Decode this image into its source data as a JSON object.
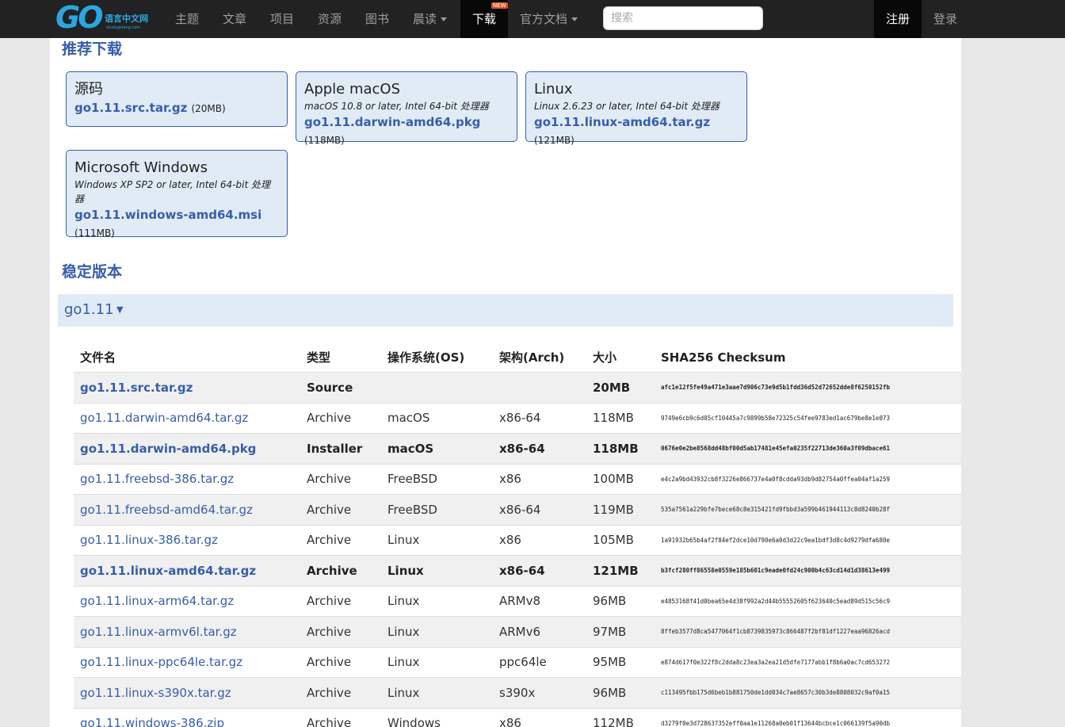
{
  "nav": {
    "logo_go": "GO",
    "logo_cn": "语言中文网",
    "logo_en": "studygolang.com",
    "items": [
      "主题",
      "文章",
      "项目",
      "资源",
      "图书",
      "晨读",
      "下载",
      "官方文档"
    ],
    "new_badge": "NEW",
    "search_placeholder": "搜索",
    "register": "注册",
    "login": "登录"
  },
  "recommended": {
    "title": "推荐下载",
    "cards": [
      {
        "title": "源码",
        "sub": "",
        "file": "go1.11.src.tar.gz",
        "size": "(20MB)"
      },
      {
        "title": "Apple macOS",
        "sub": "macOS 10.8 or later, Intel 64-bit 处理器",
        "file": "go1.11.darwin-amd64.pkg",
        "size": "(118MB)"
      },
      {
        "title": "Linux",
        "sub": "Linux 2.6.23 or later, Intel 64-bit 处理器",
        "file": "go1.11.linux-amd64.tar.gz",
        "size": "(121MB)"
      },
      {
        "title": "Microsoft Windows",
        "sub": "Windows XP SP2 or later, Intel 64-bit 处理器",
        "file": "go1.11.windows-amd64.msi",
        "size": "(111MB)"
      }
    ]
  },
  "stable": {
    "title": "稳定版本",
    "version": "go1.11",
    "toggle": "▼"
  },
  "table": {
    "headers": [
      "文件名",
      "类型",
      "操作系统(OS)",
      "架构(Arch)",
      "大小",
      "SHA256 Checksum"
    ],
    "rows": [
      {
        "file": "go1.11.src.tar.gz",
        "kind": "Source",
        "os": "",
        "arch": "",
        "size": "20MB",
        "sha": "afc1e12f5fe49a471e3aae7d906c73e9d5b1fdd36d52d72652dde8f6250152fb",
        "hl": true
      },
      {
        "file": "go1.11.darwin-amd64.tar.gz",
        "kind": "Archive",
        "os": "macOS",
        "arch": "x86-64",
        "size": "118MB",
        "sha": "9749e6cb9c6d05cf10445a7c9899b58e72325c54fee9783ed1ac679be8e1e073",
        "hl": false
      },
      {
        "file": "go1.11.darwin-amd64.pkg",
        "kind": "Installer",
        "os": "macOS",
        "arch": "x86-64",
        "size": "118MB",
        "sha": "0676e0e2be8568dd48bf00d5ab17481e45efa0235f22713de360a3f09dbace61",
        "hl": true
      },
      {
        "file": "go1.11.freebsd-386.tar.gz",
        "kind": "Archive",
        "os": "FreeBSD",
        "arch": "x86",
        "size": "100MB",
        "sha": "e4c2a9bd43932cb8f3226e866737e4a0f8cdda93db9d82754a0ffea04af1a259",
        "hl": false
      },
      {
        "file": "go1.11.freebsd-amd64.tar.gz",
        "kind": "Archive",
        "os": "FreeBSD",
        "arch": "x86-64",
        "size": "119MB",
        "sha": "535a7561a229bfe7bece68c8e315421fd9fbbd3a599b461944113c8d8240b28f",
        "hl": false
      },
      {
        "file": "go1.11.linux-386.tar.gz",
        "kind": "Archive",
        "os": "Linux",
        "arch": "x86",
        "size": "105MB",
        "sha": "1a91932b65b4af2f84ef2dce10d790e6a0d3d22c9ea1bdf3d8c4d9279dfa680e",
        "hl": false
      },
      {
        "file": "go1.11.linux-amd64.tar.gz",
        "kind": "Archive",
        "os": "Linux",
        "arch": "x86-64",
        "size": "121MB",
        "sha": "b3fcf280ff86558e0559e185b601c9eade0fd24c900b4c63cd14d1d38613e499",
        "hl": true
      },
      {
        "file": "go1.11.linux-arm64.tar.gz",
        "kind": "Archive",
        "os": "Linux",
        "arch": "ARMv8",
        "size": "96MB",
        "sha": "e4853168f41d0bea65e4d38f992a2d44b55552605f623640c5ead89d515c56c9",
        "hl": false
      },
      {
        "file": "go1.11.linux-armv6l.tar.gz",
        "kind": "Archive",
        "os": "Linux",
        "arch": "ARMv6",
        "size": "97MB",
        "sha": "8ffeb3577d8ca5477064f1cb8739835973c866487f2bf81df1227eaa96826acd",
        "hl": false
      },
      {
        "file": "go1.11.linux-ppc64le.tar.gz",
        "kind": "Archive",
        "os": "Linux",
        "arch": "ppc64le",
        "size": "95MB",
        "sha": "e874d617f0e322f8c2dda8c23ea3a2ea21d5dfe7177abb1f8b6a0ac7cd653272",
        "hl": false
      },
      {
        "file": "go1.11.linux-s390x.tar.gz",
        "kind": "Archive",
        "os": "Linux",
        "arch": "s390x",
        "size": "96MB",
        "sha": "c113495fbb175d6beb1b881750de1dd034c7ae8657c30b3de8808032c9af0a15",
        "hl": false
      },
      {
        "file": "go1.11.windows-386.zip",
        "kind": "Archive",
        "os": "Windows",
        "arch": "x86",
        "size": "112MB",
        "sha": "d3279f0e3d728637352eff0aa1e11268a0eb01f13644bcbce1c066139f5a90db",
        "hl": false
      }
    ]
  },
  "colors": {
    "link": "#375eab",
    "card_bg": "#e0ebf5",
    "nav_bg": "#222222"
  }
}
